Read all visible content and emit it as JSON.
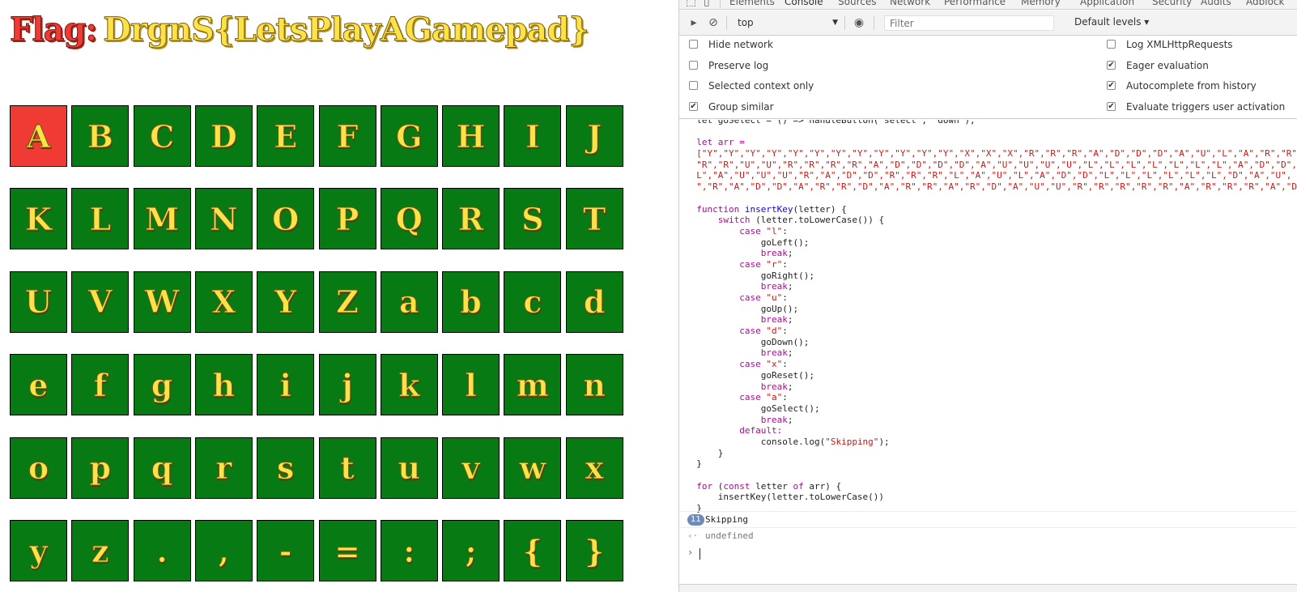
{
  "flag": {
    "label": "Flag:",
    "value": "DrgnS{LetsPlayAGamepad}"
  },
  "keyboard": {
    "selected": "A",
    "rows": [
      [
        "A",
        "B",
        "C",
        "D",
        "E",
        "F",
        "G",
        "H",
        "I",
        "J"
      ],
      [
        "K",
        "L",
        "M",
        "N",
        "O",
        "P",
        "Q",
        "R",
        "S",
        "T"
      ],
      [
        "U",
        "V",
        "W",
        "X",
        "Y",
        "Z",
        "a",
        "b",
        "c",
        "d"
      ],
      [
        "e",
        "f",
        "g",
        "h",
        "i",
        "j",
        "k",
        "l",
        "m",
        "n"
      ],
      [
        "o",
        "p",
        "q",
        "r",
        "s",
        "t",
        "u",
        "v",
        "w",
        "x"
      ],
      [
        "y",
        "z",
        ".",
        ",",
        "-",
        "=",
        ":",
        ";",
        "{",
        "}"
      ]
    ]
  },
  "devtools": {
    "tabs": [
      "Elements",
      "Console",
      "Sources",
      "Network",
      "Performance",
      "Memory",
      "Application",
      "Security",
      "Audits",
      "Adblock"
    ],
    "active_tab": "Console",
    "context": "top",
    "filter_placeholder": "Filter",
    "levels": "Default levels ▾",
    "settings_left": [
      {
        "label": "Hide network",
        "checked": false
      },
      {
        "label": "Preserve log",
        "checked": false
      },
      {
        "label": "Selected context only",
        "checked": false
      },
      {
        "label": "Group similar",
        "checked": true
      }
    ],
    "settings_right": [
      {
        "label": "Log XMLHttpRequests",
        "checked": false
      },
      {
        "label": "Eager evaluation",
        "checked": true
      },
      {
        "label": "Autocomplete from history",
        "checked": true
      },
      {
        "label": "Evaluate triggers user activation",
        "checked": true
      }
    ],
    "code": {
      "clipped_top": "let goSelect = () => handleButton('select', 'down');",
      "arr_decl": "let arr =",
      "arr_lines": [
        "[\"Y\",\"Y\",\"Y\",\"Y\",\"Y\",\"Y\",\"Y\",\"Y\",\"Y\",\"Y\",\"Y\",\"Y\",\"X\",\"X\",\"X\",\"R\",\"R\",\"R\",\"A\",\"D\",\"D\",\"D\",\"A\",\"U\",\"L\",\"A\",\"R\",\"R\"",
        "\"R\",\"R\",\"U\",\"U\",\"R\",\"R\",\"R\",\"R\",\"A\",\"D\",\"D\",\"D\",\"D\",\"A\",\"U\",\"U\",\"U\",\"U\",\"L\",\"L\",\"L\",\"L\",\"L\",\"L\",\"L\",\"A\",\"D\",\"D\",",
        "L\",\"A\",\"U\",\"U\",\"U\",\"R\",\"A\",\"D\",\"D\",\"R\",\"R\",\"R\",\"L\",\"A\",\"U\",\"L\",\"A\",\"D\",\"D\",\"L\",\"L\",\"L\",\"L\",\"L\",\"L\",\"D\",\"A\",\"U\",",
        "\",\"R\",\"A\",\"D\",\"D\",\"A\",\"R\",\"R\",\"D\",\"A\",\"R\",\"R\",\"A\",\"R\",\"D\",\"A\",\"U\",\"U\",\"R\",\"R\",\"R\",\"R\",\"R\",\"A\",\"R\",\"R\",\"R\",\"A\",\"D"
      ],
      "fn_decl_kw": "function",
      "fn_decl_name": "insertKey",
      "fn_decl_args": "(letter) {",
      "switch_kw": "switch",
      "switch_expr": " (letter.toLowerCase()) {",
      "cases": [
        {
          "val": "\"l\"",
          "call": "goLeft();"
        },
        {
          "val": "\"r\"",
          "call": "goRight();"
        },
        {
          "val": "\"u\"",
          "call": "goUp();"
        },
        {
          "val": "\"d\"",
          "call": "goDown();"
        },
        {
          "val": "\"x\"",
          "call": "goReset();"
        },
        {
          "val": "\"a\"",
          "call": "goSelect();"
        }
      ],
      "case_kw": "case",
      "break_kw": "break",
      "default_kw": "default:",
      "default_call_pre": "console.log(",
      "default_call_str": "\"Skipping\"",
      "default_call_post": ");",
      "close_inner": "    }",
      "close_outer": "}",
      "for_kw": "for",
      "for_rest_a": " (",
      "for_const": "const",
      "for_rest_b": " letter ",
      "for_of": "of",
      "for_rest_c": " arr) {",
      "for_body": "    insertKey(letter.toLowerCase())",
      "for_close": "}"
    },
    "message_count": "11",
    "message_text": "Skipping",
    "result_text": "undefined"
  }
}
